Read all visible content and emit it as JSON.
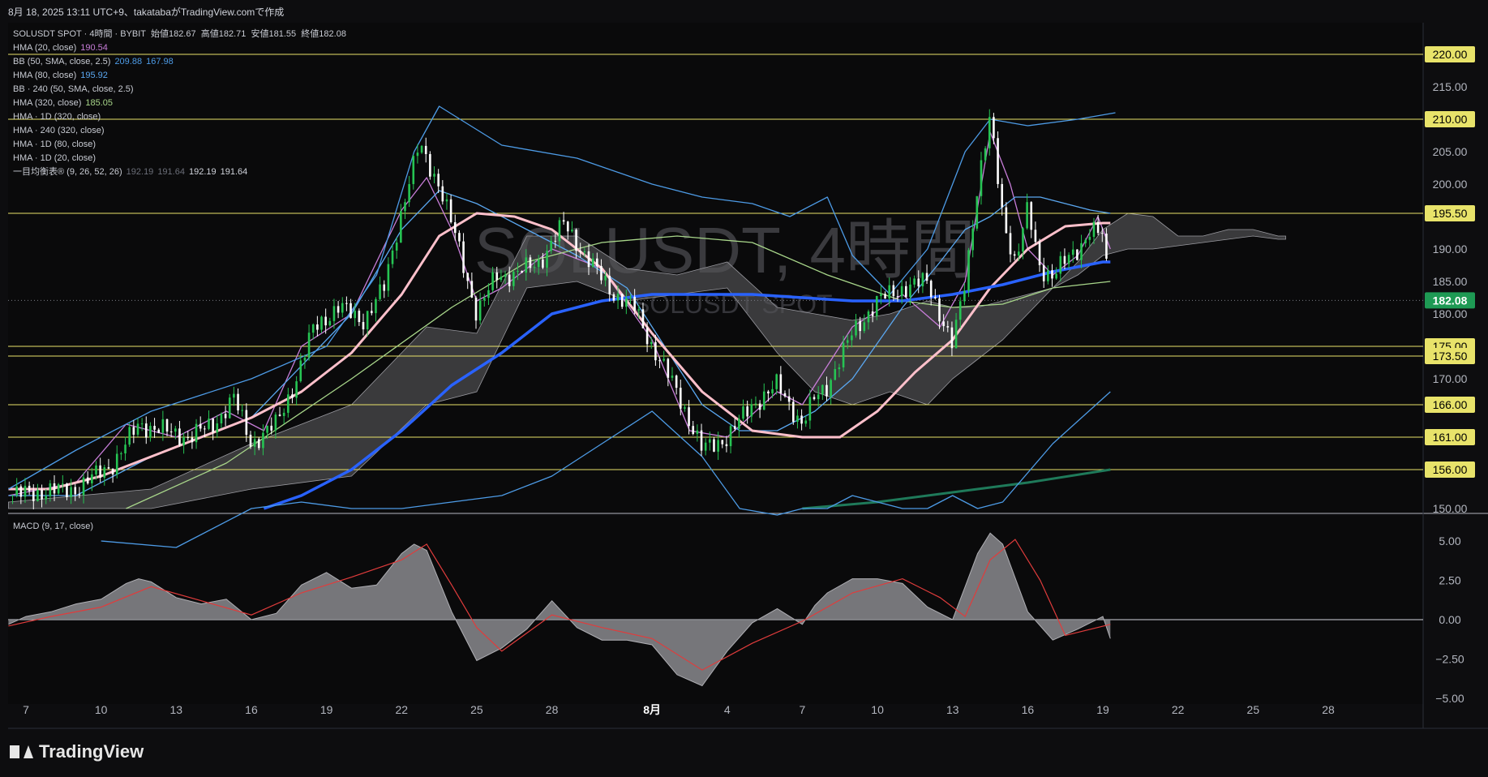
{
  "header": {
    "title": "8月 18, 2025 13:11 UTC+9、takatabaがTradingView.comで作成"
  },
  "legend": {
    "main": {
      "symbol": "SOLUSDT SPOT · 4時間 · BYBIT",
      "open_label": "始値",
      "open": "182.67",
      "high_label": "高値",
      "high": "182.71",
      "low_label": "安値",
      "low": "181.55",
      "close_label": "終値",
      "close": "182.08"
    },
    "indicators": [
      {
        "name": "HMA (20, close)",
        "value": "190.54",
        "value2": "",
        "color": "#c77dd8"
      },
      {
        "name": "BB (50, SMA, close, 2.5)",
        "value": "209.88",
        "value2": "167.98",
        "color": "#4d9be6"
      },
      {
        "name": "HMA (80, close)",
        "value": "195.92",
        "value2": "",
        "color": "#5aa7f0"
      },
      {
        "name": "BB · 240 (50, SMA, close, 2.5)",
        "value": "",
        "value2": "",
        "color": "#c8cbd3"
      },
      {
        "name": "HMA (320, close)",
        "value": "185.05",
        "value2": "",
        "color": "#a8d68a"
      },
      {
        "name": "HMA · 1D (320, close)",
        "value": "",
        "value2": "",
        "color": "#c8cbd3"
      },
      {
        "name": "HMA · 240 (320, close)",
        "value": "",
        "value2": "",
        "color": "#c8cbd3"
      },
      {
        "name": "HMA · 1D (80, close)",
        "value": "",
        "value2": "",
        "color": "#c8cbd3"
      },
      {
        "name": "HMA · 1D (20, close)",
        "value": "",
        "value2": "",
        "color": "#c8cbd3"
      },
      {
        "name": "一目均衡表® (9, 26, 52, 26)",
        "value": "192.19",
        "value2": "191.64",
        "value3": "192.19",
        "value4": "191.64",
        "color": "#c8cbd3"
      }
    ],
    "macd": {
      "name": "MACD (9, 17, close)"
    }
  },
  "watermark": {
    "main": "SOLUSDT, 4時間",
    "sub": "SOLUSDT SPOT"
  },
  "brand": {
    "name": "TradingView"
  },
  "colors": {
    "up": "#26c453",
    "down": "#ffffff",
    "hma20": "#c77dd8",
    "hma80": "#5aa7f0",
    "hma320": "#a8d68a",
    "bb": "#4d9be6",
    "pink": "#ffc0cb",
    "blue": "#2962ff",
    "teal": "#1f7a5a",
    "level": "#e8e36a",
    "cloud": "#555558"
  },
  "chart_data": [
    {
      "type": "line",
      "title": "SOLUSDT SPOT · 4時間 · BYBIT",
      "y_ticks": [
        "220.00",
        "215.00",
        "210.00",
        "205.00",
        "200.00",
        "195.50",
        "190.00",
        "185.00",
        "182.08",
        "180.00",
        "175.00",
        "173.50",
        "170.00",
        "166.00",
        "161.00",
        "156.00",
        "150.00"
      ],
      "ylim": [
        150,
        220
      ],
      "x_ticks": [
        "7",
        "10",
        "13",
        "16",
        "19",
        "22",
        "25",
        "28",
        "8月",
        "4",
        "7",
        "10",
        "13",
        "16",
        "19",
        "22",
        "25",
        "28"
      ],
      "x_tick_days": [
        7,
        10,
        13,
        16,
        19,
        22,
        25,
        28,
        32,
        35,
        38,
        41,
        44,
        47,
        50,
        53,
        56,
        59
      ],
      "xlim": [
        6.3,
        63.6
      ],
      "horizontal_levels": [
        {
          "value": 220.0,
          "label": "220.00"
        },
        {
          "value": 210.0,
          "label": "210.00"
        },
        {
          "value": 195.5,
          "label": "195.50"
        },
        {
          "value": 175.0,
          "label": "175.00"
        },
        {
          "value": 173.5,
          "label": "173.50"
        },
        {
          "value": 166.0,
          "label": "166.00"
        },
        {
          "value": 161.0,
          "label": "161.00"
        },
        {
          "value": 156.0,
          "label": "156.00"
        }
      ],
      "last_price": {
        "value": 182.08,
        "label": "182.08"
      },
      "price_path": {
        "x": [
          6.3,
          7.5,
          9,
          10.5,
          11.5,
          12.5,
          13.5,
          14.5,
          15.3,
          16,
          17,
          17.8,
          18.5,
          19.5,
          20.5,
          21.3,
          22,
          22.7,
          23.5,
          24.3,
          25,
          25.8,
          26.5,
          27.5,
          28.5,
          29.5,
          30.5,
          31.3,
          32,
          33,
          34,
          35,
          36,
          37,
          38,
          38.5,
          39,
          40,
          41,
          42,
          43,
          44,
          44.5,
          45,
          45.5,
          46,
          46.5,
          47,
          47.5,
          48,
          48.5,
          49,
          49.5,
          50,
          50.3
        ],
        "y": [
          152,
          152.5,
          153,
          157,
          163,
          162,
          161,
          163,
          167,
          160,
          163,
          170,
          178,
          181,
          179,
          184,
          196,
          206,
          200,
          190,
          180,
          186,
          186,
          188,
          194,
          188,
          183,
          181,
          175,
          168,
          159,
          161,
          166,
          169,
          163,
          167,
          169,
          177,
          182,
          184,
          185,
          175,
          185,
          200,
          210,
          195,
          188,
          196,
          187,
          186,
          188,
          190,
          193,
          192,
          182
        ]
      },
      "series": [
        {
          "name": "HMA (20, close)",
          "color": "#c77dd8",
          "x": [
            6.3,
            9,
            11,
            13,
            15,
            16.5,
            18,
            20,
            22,
            23,
            24,
            25,
            26,
            28,
            30,
            32,
            33.5,
            35,
            37,
            38,
            40,
            42,
            43.5,
            44.5,
            45.5,
            46.3,
            47,
            48,
            49,
            49.8,
            50.3
          ],
          "y": [
            152,
            154,
            163,
            161,
            165,
            162,
            175,
            180,
            196,
            201,
            193,
            182,
            184,
            190,
            187,
            176,
            162,
            161,
            168,
            166,
            178,
            183,
            178,
            185,
            208,
            200,
            190,
            186,
            189,
            195,
            190
          ]
        },
        {
          "name": "HMA (80, close)",
          "color": "#5aa7f0",
          "x": [
            6.3,
            9,
            12,
            16,
            20,
            22,
            23.5,
            25,
            27,
            29,
            31,
            32.5,
            34,
            35.5,
            37,
            38.5,
            40,
            42,
            43.5,
            44.5,
            45.5,
            46.5,
            47.5,
            48.5,
            49.5,
            50.3
          ],
          "y": [
            152,
            152,
            158,
            164,
            180,
            193,
            199,
            197,
            193,
            189,
            184,
            175,
            166,
            162,
            162,
            165,
            170,
            181,
            188,
            193,
            195,
            198,
            198,
            197,
            196,
            195.5
          ]
        },
        {
          "name": "HMA (320, close)",
          "color": "#a8d68a",
          "x": [
            11,
            15,
            20,
            24,
            27,
            30,
            33,
            36,
            39,
            42,
            44,
            46,
            48,
            50.3
          ],
          "y": [
            150,
            157,
            170,
            181,
            188,
            191,
            192,
            191,
            186,
            182,
            181,
            181.5,
            184,
            185
          ]
        },
        {
          "name": "HMA · 1D (20, close)",
          "color": "#ffc0cb",
          "x": [
            6.3,
            8,
            10,
            12,
            14,
            16,
            18,
            20,
            22,
            23.5,
            25,
            26.5,
            28,
            30,
            32,
            34,
            36,
            38,
            39.5,
            41,
            42.5,
            44,
            45.5,
            47,
            48.5,
            50,
            50.3
          ],
          "y": [
            153,
            153,
            155,
            158,
            161,
            164,
            168,
            174,
            183,
            192,
            195.5,
            195,
            193,
            187,
            177,
            168,
            162,
            161,
            161,
            165,
            171,
            176,
            184,
            190,
            193.5,
            194,
            194
          ]
        },
        {
          "name": "HMA · 240 (320, close)",
          "color": "#2962ff",
          "x": [
            16.5,
            18,
            20,
            22,
            24,
            26,
            28,
            30,
            32,
            34,
            36,
            38,
            40,
            42,
            44,
            46,
            48,
            50,
            50.3
          ],
          "y": [
            150,
            152,
            156,
            162,
            169,
            174,
            180,
            182,
            183,
            183,
            183,
            182.5,
            182,
            182,
            183,
            184.5,
            186.5,
            188,
            188
          ]
        },
        {
          "name": "HMA · 1D (320, close)",
          "color": "#1f7a5a",
          "x": [
            38,
            41,
            44,
            47,
            50.3
          ],
          "y": [
            150,
            151,
            152.5,
            154,
            156
          ]
        },
        {
          "name": "BB (50, SMA, close, 2.5) upper",
          "color": "#4d9be6",
          "x": [
            6.3,
            9,
            12,
            16,
            19,
            21,
            22.5,
            23.5,
            26,
            29,
            32,
            34,
            36,
            37.5,
            39,
            40,
            41.5,
            43,
            44.5,
            45.5,
            47,
            49,
            50.5
          ],
          "y": [
            153,
            159,
            165,
            170,
            175,
            186,
            205,
            212,
            206,
            204,
            200,
            198,
            197,
            195,
            198,
            189,
            183,
            190,
            205,
            210,
            209,
            210,
            211
          ]
        },
        {
          "name": "BB (50, SMA, close, 2.5) lower",
          "color": "#4d9be6",
          "x": [
            10,
            13,
            16,
            18,
            20,
            22,
            24,
            26,
            28,
            30,
            32,
            34,
            35.5,
            37,
            38,
            39,
            40,
            41,
            42,
            43,
            44,
            45,
            46,
            48,
            50.3
          ],
          "y": [
            145,
            144,
            150,
            151,
            150,
            150,
            151,
            152,
            155,
            160,
            165,
            158,
            150,
            149,
            150,
            150,
            152,
            151,
            150,
            150,
            152,
            150,
            151,
            160,
            168
          ]
        }
      ],
      "ichimoku_cloud": {
        "x": [
          6.3,
          12,
          16,
          20,
          23,
          25,
          27,
          29,
          31,
          33,
          35,
          37,
          38.5,
          40,
          41.5,
          43,
          44,
          45,
          46,
          47,
          48,
          49,
          50,
          51,
          52,
          53,
          54,
          55,
          56,
          57,
          57.3
        ],
        "upper": [
          151,
          153,
          160,
          166,
          178,
          177,
          192,
          192,
          187,
          186,
          188,
          181,
          180,
          179,
          180,
          182,
          181,
          181,
          182,
          183,
          184,
          188,
          193,
          195.5,
          195,
          192,
          192,
          193,
          193,
          192,
          192
        ],
        "lower": [
          150,
          150,
          153,
          155,
          166,
          168,
          184,
          185,
          182,
          183,
          184,
          174,
          168,
          166,
          168,
          166,
          170,
          173,
          176,
          180,
          184,
          186,
          189,
          190,
          190,
          190.5,
          191,
          191.5,
          192,
          191.5,
          191.5
        ]
      }
    },
    {
      "type": "area",
      "title": "MACD (9, 17, close)",
      "y_ticks": [
        "5.00",
        "2.50",
        "0.00",
        "−2.50",
        "−5.00"
      ],
      "ylim": [
        -5,
        5
      ],
      "macd": {
        "x": [
          6.3,
          7,
          8,
          9,
          10,
          11,
          11.5,
          12,
          13,
          14,
          15,
          16,
          17,
          18,
          19,
          20,
          21,
          22,
          22.5,
          23,
          24,
          25,
          26,
          27,
          28,
          29,
          30,
          31,
          32,
          33,
          34,
          35,
          36,
          37,
          38,
          38.5,
          39,
          40,
          41,
          42,
          43,
          44,
          44.5,
          45,
          45.5,
          46,
          47,
          48,
          49,
          50,
          50.3
        ],
        "y": [
          -0.3,
          0.2,
          0.5,
          1.0,
          1.3,
          2.3,
          2.6,
          2.4,
          1.4,
          1.0,
          1.3,
          0.0,
          0.4,
          2.2,
          3.0,
          2.0,
          2.2,
          4.2,
          4.8,
          4.4,
          0.5,
          -2.6,
          -1.8,
          -0.6,
          1.2,
          -0.5,
          -1.3,
          -1.3,
          -1.6,
          -3.5,
          -4.2,
          -2.0,
          -0.2,
          0.7,
          -0.3,
          0.9,
          1.7,
          2.6,
          2.6,
          2.3,
          0.8,
          0.0,
          2.1,
          4.2,
          5.5,
          4.8,
          0.5,
          -1.3,
          -0.6,
          0.2,
          -1.2
        ]
      },
      "signal": {
        "x": [
          6.3,
          8,
          10,
          12,
          14,
          16,
          18,
          20,
          22,
          23,
          24,
          25,
          26,
          28,
          30,
          32,
          34,
          36,
          38,
          40,
          42,
          43.5,
          44.5,
          45.5,
          46.5,
          47.5,
          48.5,
          50.3
        ],
        "y": [
          -0.4,
          0.2,
          0.8,
          2.1,
          1.2,
          0.3,
          1.7,
          2.7,
          3.8,
          4.8,
          2.2,
          -0.5,
          -2.0,
          0.3,
          -0.5,
          -1.2,
          -3.2,
          -1.5,
          -0.1,
          1.7,
          2.6,
          1.4,
          0.2,
          3.8,
          5.1,
          2.5,
          -1.0,
          -0.3
        ]
      }
    }
  ]
}
